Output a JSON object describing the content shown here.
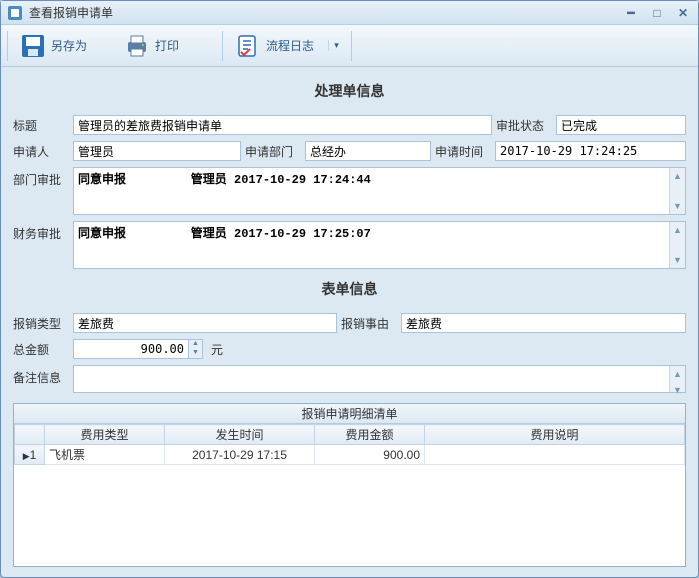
{
  "window": {
    "title": "查看报销申请单"
  },
  "toolbar": {
    "saveas_label": "另存为",
    "print_label": "打印",
    "log_label": "流程日志"
  },
  "section1_title": "处理单信息",
  "section2_title": "表单信息",
  "labels": {
    "title": "标题",
    "approval_status": "审批状态",
    "applicant": "申请人",
    "apply_dept": "申请部门",
    "apply_time": "申请时间",
    "dept_approve": "部门审批",
    "finance_approve": "财务审批",
    "reimburse_type": "报销类型",
    "reimburse_reason": "报销事由",
    "total_amount": "总金额",
    "currency_unit": "元",
    "remark": "备注信息"
  },
  "fields": {
    "title": "管理员的差旅费报销申请单",
    "approval_status": "已完成",
    "applicant": "管理员",
    "apply_dept": "总经办",
    "apply_time": "2017-10-29 17:24:25",
    "dept_approve_line": "同意申报         管理员 2017-10-29 17:24:44",
    "finance_approve_line": "同意申报         管理员 2017-10-29 17:25:07",
    "reimburse_type": "差旅费",
    "reimburse_reason": "差旅费",
    "total_amount": "900.00",
    "remark": ""
  },
  "table": {
    "caption": "报销申请明细清单",
    "columns": {
      "idx": "",
      "type": "费用类型",
      "time": "发生时间",
      "amount": "费用金额",
      "desc": "费用说明"
    },
    "rows": [
      {
        "idx": "1",
        "type": "飞机票",
        "time": "2017-10-29 17:15",
        "amount": "900.00",
        "desc": ""
      }
    ]
  }
}
